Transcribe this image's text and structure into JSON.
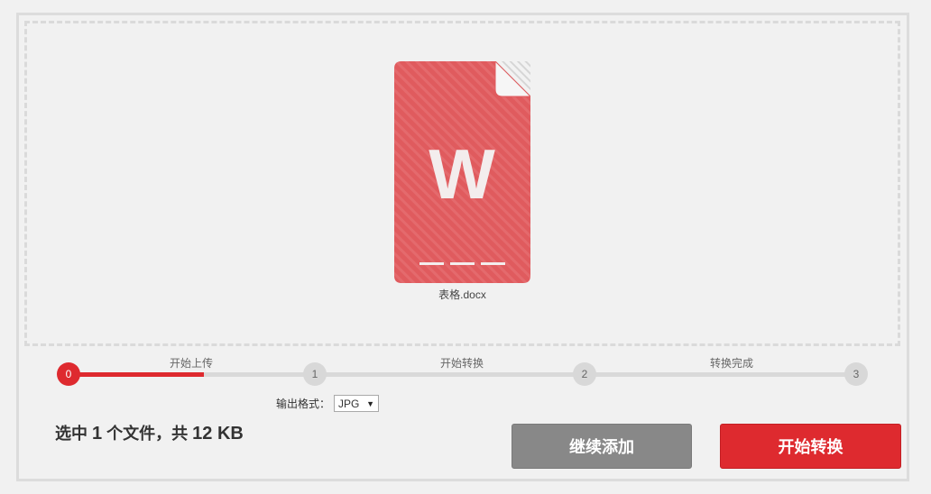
{
  "file": {
    "icon_letter": "W",
    "name": "表格.docx",
    "icon_color": "#e05b5e"
  },
  "steps": {
    "labels": [
      "开始上传",
      "开始转换",
      "转换完成"
    ],
    "nodes": [
      "0",
      "1",
      "2",
      "3"
    ],
    "progress": 0.55,
    "active_color": "#de2a2f"
  },
  "format": {
    "label": "输出格式：",
    "selected": "JPG",
    "arrow": "▼"
  },
  "summary": {
    "prefix": "选中 ",
    "count": "1",
    "middle": " 个文件，共 ",
    "size": "12 KB"
  },
  "buttons": {
    "add_label": "继续添加",
    "start_label": "开始转换"
  }
}
